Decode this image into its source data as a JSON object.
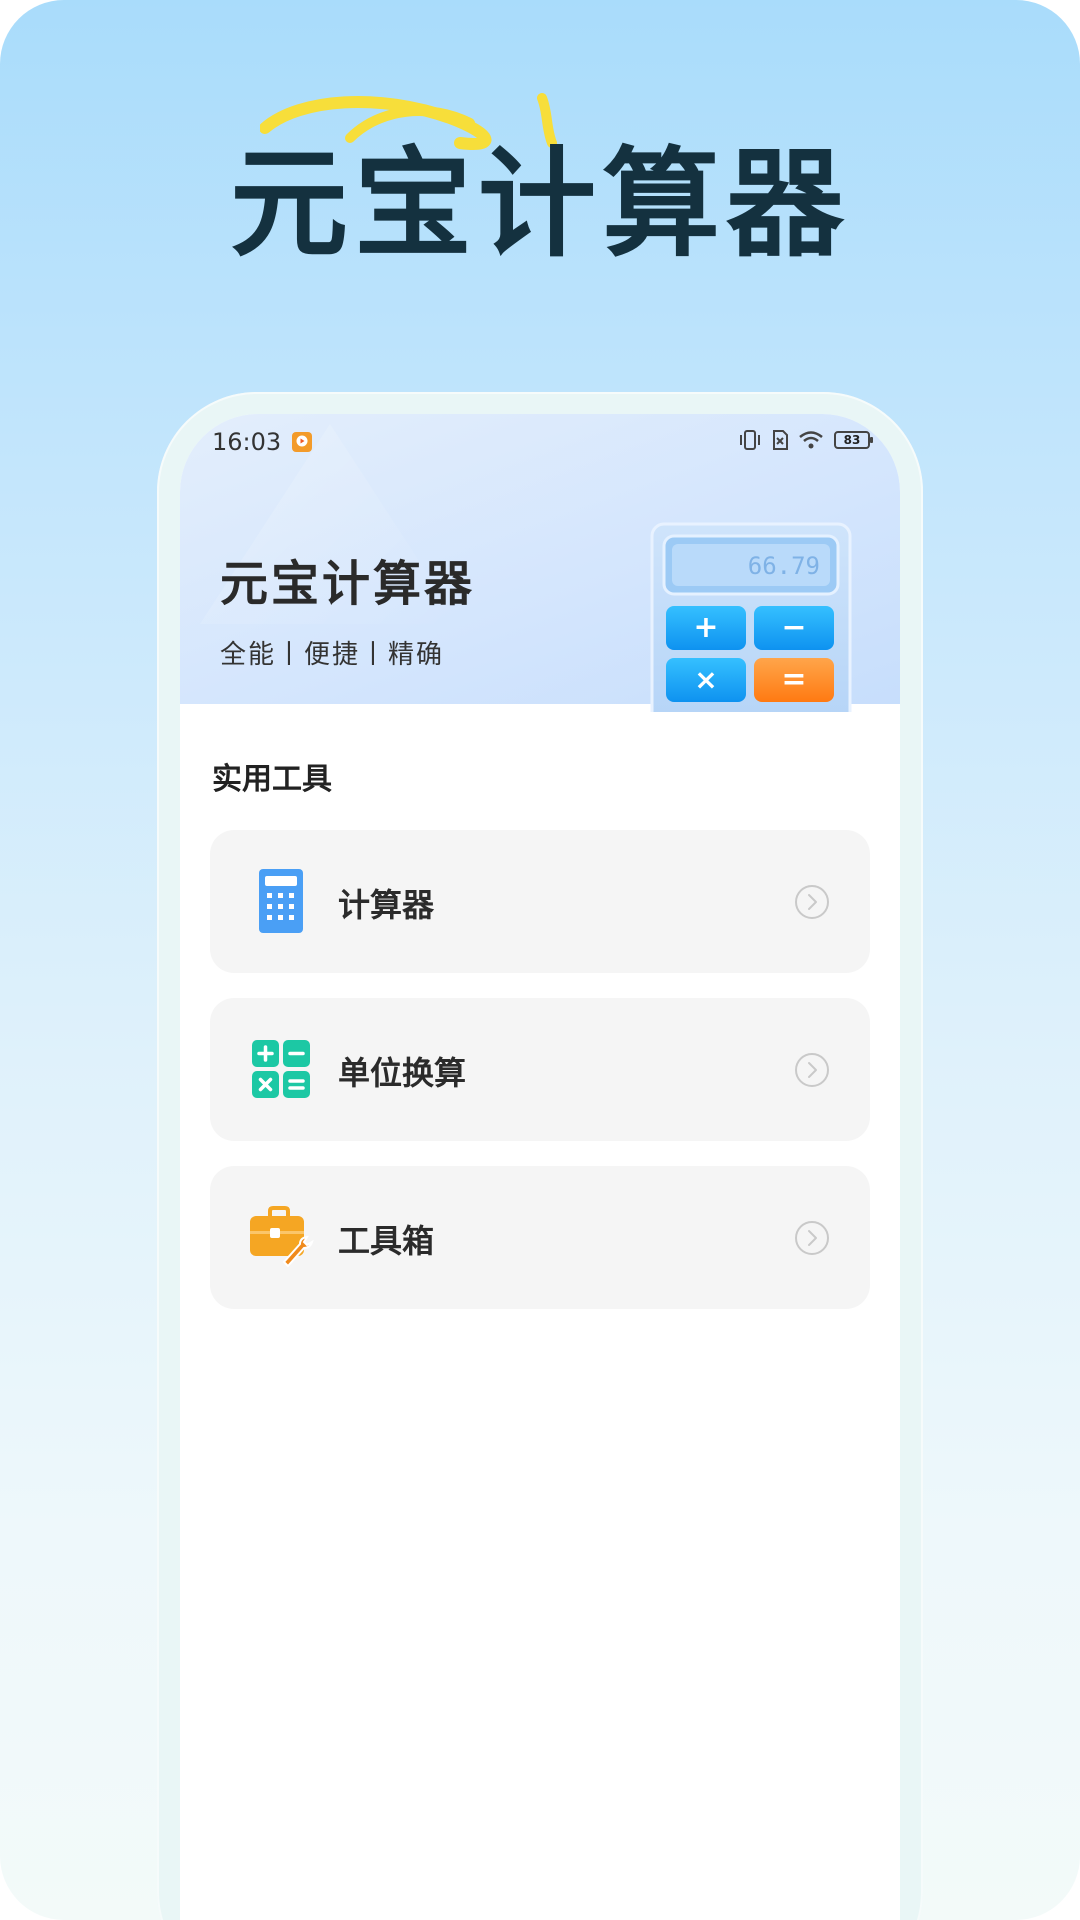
{
  "hero": {
    "title": "元宝计算器"
  },
  "status_bar": {
    "time": "16:03",
    "battery_level": "83"
  },
  "header": {
    "app_title": "元宝计算器",
    "tagline": "全能丨便捷丨精确",
    "illustration": {
      "display_value": "66.79",
      "keys": [
        "+",
        "−",
        "×",
        "="
      ]
    }
  },
  "section": {
    "title": "实用工具"
  },
  "tools": [
    {
      "label": "计算器",
      "icon": "calculator-icon"
    },
    {
      "label": "单位换算",
      "icon": "unit-conversion-icon"
    },
    {
      "label": "工具箱",
      "icon": "toolbox-icon"
    }
  ],
  "colors": {
    "calculator_icon": "#4a9ff5",
    "unit_icon": "#1cc8a4",
    "toolbox_icon": "#f5a623",
    "hero_text": "#14313f",
    "swirl": "#f7de3a"
  }
}
